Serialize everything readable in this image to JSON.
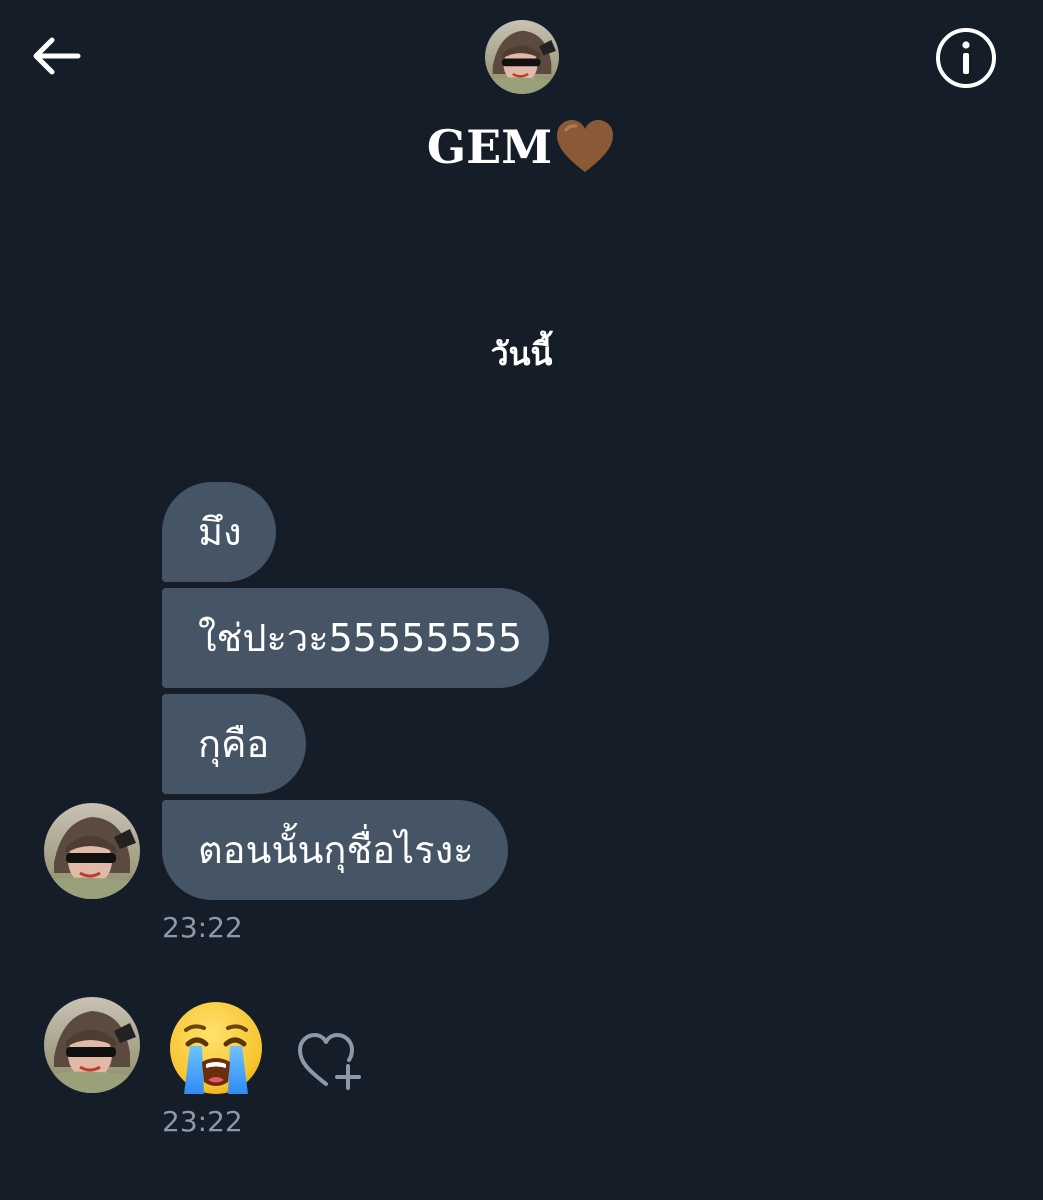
{
  "header": {
    "contact_name": "GEM",
    "name_emoji_icon": "brown-heart-icon",
    "back_icon": "arrow-left-icon",
    "info_icon": "info-icon"
  },
  "conversation": {
    "date_separator": "วันนี้",
    "message_group_1": {
      "messages": [
        "มึง",
        "ใช่ปะวะ55555555",
        "กุคือ",
        "ตอนนั้นกุชื่อไรงะ"
      ],
      "time": "23:22"
    },
    "message_group_2": {
      "emoji_icon": "loudly-crying-face-icon",
      "react_icon": "heart-plus-icon",
      "time": "23:22"
    }
  },
  "colors": {
    "background": "#151d29",
    "bubble": "#455566",
    "timestamp": "#8c99a8",
    "heart": "#8a5a36"
  }
}
